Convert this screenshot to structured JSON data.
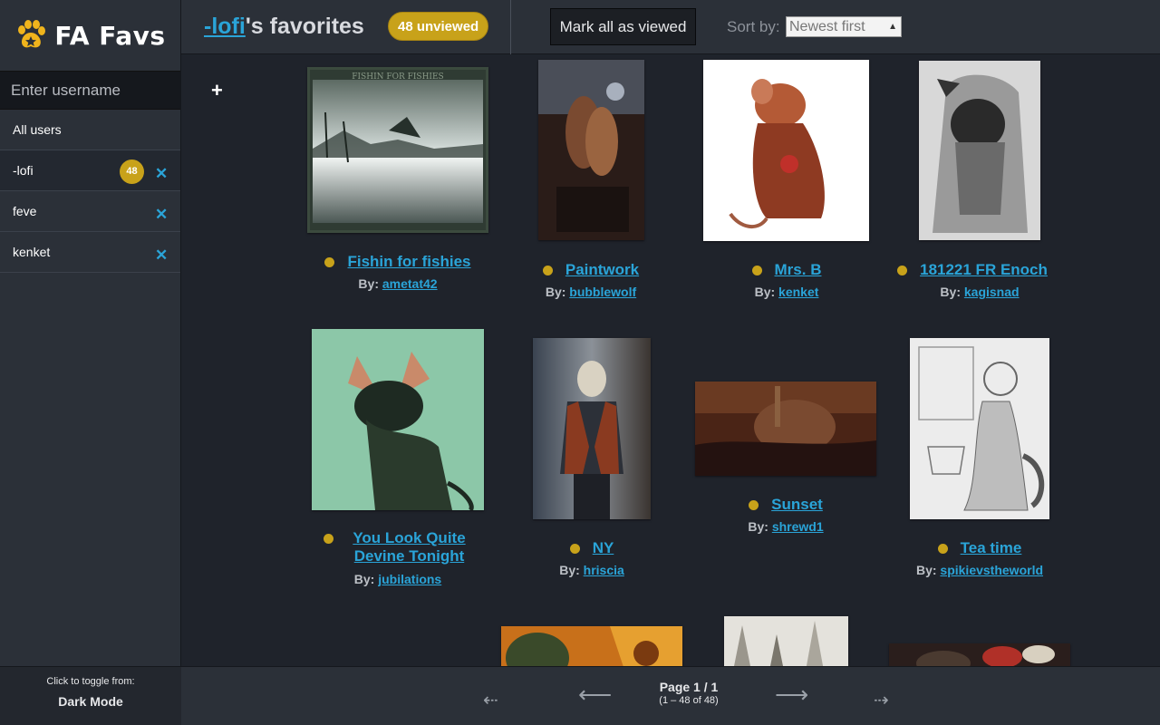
{
  "app": {
    "name": "FA Favs"
  },
  "sidebar": {
    "input_placeholder": "Enter username",
    "all_users": "All users",
    "users": [
      {
        "name": "-lofi",
        "badge": "48",
        "active": true
      },
      {
        "name": "feve",
        "badge": null,
        "active": false
      },
      {
        "name": "kenket",
        "badge": null,
        "active": false
      }
    ],
    "toggle_hint": "Click to toggle from:",
    "toggle_mode": "Dark Mode"
  },
  "header": {
    "user": "-lofi",
    "title_suffix": "'s favorites",
    "unviewed": "48 unviewed",
    "mark_all": "Mark all as viewed",
    "sort_label": "Sort by:",
    "sort_value": "Newest first"
  },
  "gallery": {
    "by_label": "By:",
    "items": [
      {
        "title": "Fishin for fishies",
        "author": "ametat42",
        "unviewed": true
      },
      {
        "title": "Paintwork",
        "author": "bubblewolf",
        "unviewed": true
      },
      {
        "title": "Mrs. B",
        "author": "kenket",
        "unviewed": true
      },
      {
        "title": "181221 FR Enoch",
        "author": "kagisnad",
        "unviewed": true
      },
      {
        "title": "You Look Quite Devine Tonight",
        "author": "jubilations",
        "unviewed": true
      },
      {
        "title": "NY",
        "author": "hriscia",
        "unviewed": true
      },
      {
        "title": "Sunset",
        "author": "shrewd1",
        "unviewed": true
      },
      {
        "title": "Tea time",
        "author": "spikievstheworld",
        "unviewed": true
      }
    ]
  },
  "pagination": {
    "page": "Page 1 / 1",
    "range": "(1 – 48 of 48)"
  },
  "colors": {
    "accent_link": "#2aa4d8",
    "badge_gold": "#c8a21a",
    "background": "#1f232b",
    "panel": "#2b3038"
  }
}
